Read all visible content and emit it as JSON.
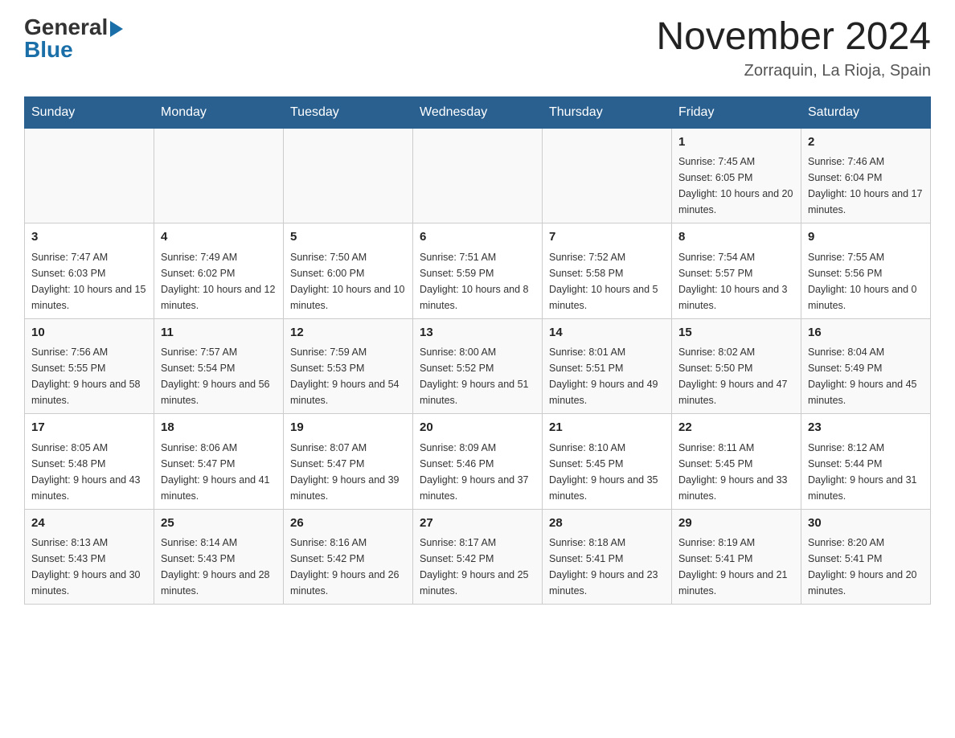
{
  "header": {
    "logo_general": "General",
    "logo_blue": "Blue",
    "title": "November 2024",
    "subtitle": "Zorraquin, La Rioja, Spain"
  },
  "days_of_week": [
    "Sunday",
    "Monday",
    "Tuesday",
    "Wednesday",
    "Thursday",
    "Friday",
    "Saturday"
  ],
  "weeks": [
    [
      {
        "day": "",
        "info": ""
      },
      {
        "day": "",
        "info": ""
      },
      {
        "day": "",
        "info": ""
      },
      {
        "day": "",
        "info": ""
      },
      {
        "day": "",
        "info": ""
      },
      {
        "day": "1",
        "info": "Sunrise: 7:45 AM\nSunset: 6:05 PM\nDaylight: 10 hours and 20 minutes."
      },
      {
        "day": "2",
        "info": "Sunrise: 7:46 AM\nSunset: 6:04 PM\nDaylight: 10 hours and 17 minutes."
      }
    ],
    [
      {
        "day": "3",
        "info": "Sunrise: 7:47 AM\nSunset: 6:03 PM\nDaylight: 10 hours and 15 minutes."
      },
      {
        "day": "4",
        "info": "Sunrise: 7:49 AM\nSunset: 6:02 PM\nDaylight: 10 hours and 12 minutes."
      },
      {
        "day": "5",
        "info": "Sunrise: 7:50 AM\nSunset: 6:00 PM\nDaylight: 10 hours and 10 minutes."
      },
      {
        "day": "6",
        "info": "Sunrise: 7:51 AM\nSunset: 5:59 PM\nDaylight: 10 hours and 8 minutes."
      },
      {
        "day": "7",
        "info": "Sunrise: 7:52 AM\nSunset: 5:58 PM\nDaylight: 10 hours and 5 minutes."
      },
      {
        "day": "8",
        "info": "Sunrise: 7:54 AM\nSunset: 5:57 PM\nDaylight: 10 hours and 3 minutes."
      },
      {
        "day": "9",
        "info": "Sunrise: 7:55 AM\nSunset: 5:56 PM\nDaylight: 10 hours and 0 minutes."
      }
    ],
    [
      {
        "day": "10",
        "info": "Sunrise: 7:56 AM\nSunset: 5:55 PM\nDaylight: 9 hours and 58 minutes."
      },
      {
        "day": "11",
        "info": "Sunrise: 7:57 AM\nSunset: 5:54 PM\nDaylight: 9 hours and 56 minutes."
      },
      {
        "day": "12",
        "info": "Sunrise: 7:59 AM\nSunset: 5:53 PM\nDaylight: 9 hours and 54 minutes."
      },
      {
        "day": "13",
        "info": "Sunrise: 8:00 AM\nSunset: 5:52 PM\nDaylight: 9 hours and 51 minutes."
      },
      {
        "day": "14",
        "info": "Sunrise: 8:01 AM\nSunset: 5:51 PM\nDaylight: 9 hours and 49 minutes."
      },
      {
        "day": "15",
        "info": "Sunrise: 8:02 AM\nSunset: 5:50 PM\nDaylight: 9 hours and 47 minutes."
      },
      {
        "day": "16",
        "info": "Sunrise: 8:04 AM\nSunset: 5:49 PM\nDaylight: 9 hours and 45 minutes."
      }
    ],
    [
      {
        "day": "17",
        "info": "Sunrise: 8:05 AM\nSunset: 5:48 PM\nDaylight: 9 hours and 43 minutes."
      },
      {
        "day": "18",
        "info": "Sunrise: 8:06 AM\nSunset: 5:47 PM\nDaylight: 9 hours and 41 minutes."
      },
      {
        "day": "19",
        "info": "Sunrise: 8:07 AM\nSunset: 5:47 PM\nDaylight: 9 hours and 39 minutes."
      },
      {
        "day": "20",
        "info": "Sunrise: 8:09 AM\nSunset: 5:46 PM\nDaylight: 9 hours and 37 minutes."
      },
      {
        "day": "21",
        "info": "Sunrise: 8:10 AM\nSunset: 5:45 PM\nDaylight: 9 hours and 35 minutes."
      },
      {
        "day": "22",
        "info": "Sunrise: 8:11 AM\nSunset: 5:45 PM\nDaylight: 9 hours and 33 minutes."
      },
      {
        "day": "23",
        "info": "Sunrise: 8:12 AM\nSunset: 5:44 PM\nDaylight: 9 hours and 31 minutes."
      }
    ],
    [
      {
        "day": "24",
        "info": "Sunrise: 8:13 AM\nSunset: 5:43 PM\nDaylight: 9 hours and 30 minutes."
      },
      {
        "day": "25",
        "info": "Sunrise: 8:14 AM\nSunset: 5:43 PM\nDaylight: 9 hours and 28 minutes."
      },
      {
        "day": "26",
        "info": "Sunrise: 8:16 AM\nSunset: 5:42 PM\nDaylight: 9 hours and 26 minutes."
      },
      {
        "day": "27",
        "info": "Sunrise: 8:17 AM\nSunset: 5:42 PM\nDaylight: 9 hours and 25 minutes."
      },
      {
        "day": "28",
        "info": "Sunrise: 8:18 AM\nSunset: 5:41 PM\nDaylight: 9 hours and 23 minutes."
      },
      {
        "day": "29",
        "info": "Sunrise: 8:19 AM\nSunset: 5:41 PM\nDaylight: 9 hours and 21 minutes."
      },
      {
        "day": "30",
        "info": "Sunrise: 8:20 AM\nSunset: 5:41 PM\nDaylight: 9 hours and 20 minutes."
      }
    ]
  ]
}
